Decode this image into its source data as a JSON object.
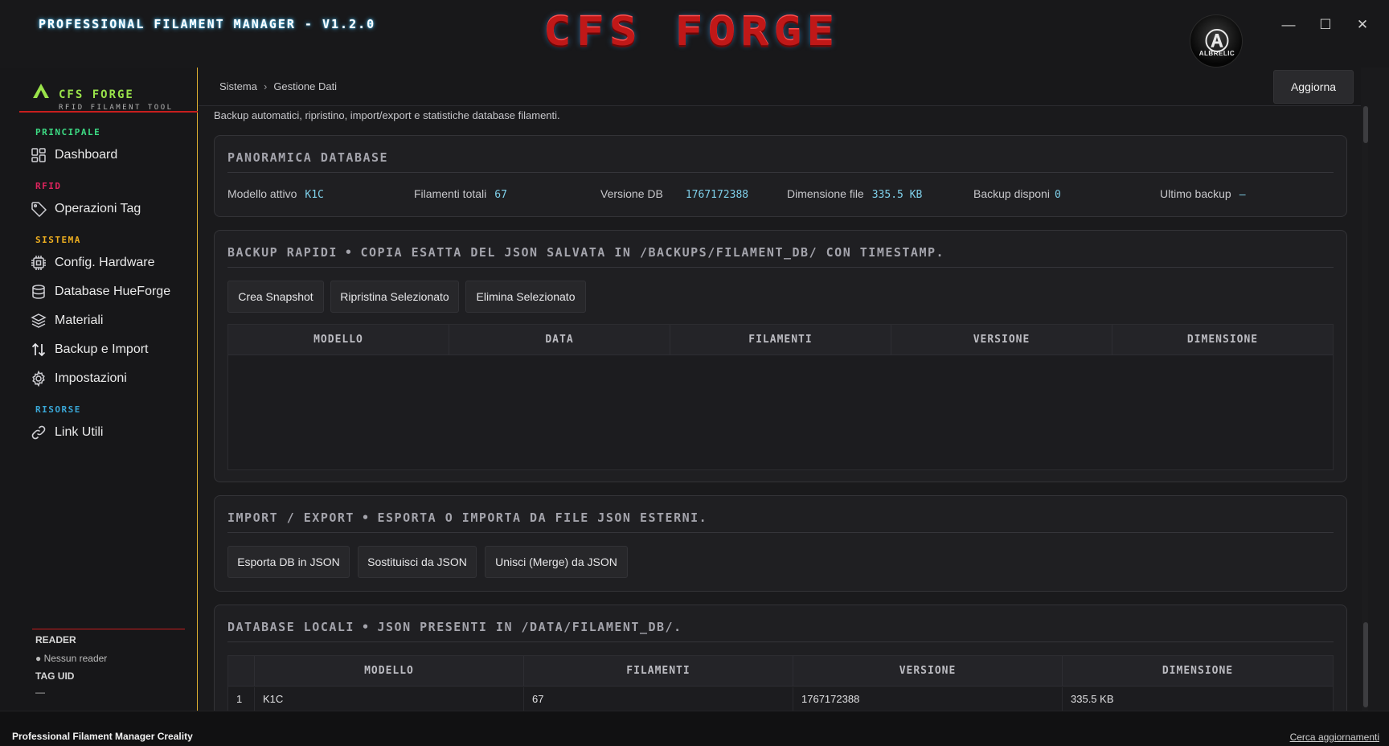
{
  "window": {
    "title": "PROFESSIONAL FILAMENT MANAGER - V1.2.0",
    "logo_text": "CFS FORGE",
    "avatar_label": "ALBRELIC",
    "controls": {
      "minimize": "—",
      "maximize": "☐",
      "close": "✕"
    }
  },
  "sidebar": {
    "brand_name": "CFS FORGE",
    "brand_sub": "RFID FILAMENT TOOL",
    "sections": [
      {
        "label": "PRINCIPALE",
        "color": "#3ddc84",
        "items": [
          {
            "label": "Dashboard",
            "icon": "dashboard-icon"
          }
        ]
      },
      {
        "label": "RFID",
        "color": "#e0245e",
        "items": [
          {
            "label": "Operazioni Tag",
            "icon": "tag-icon"
          }
        ]
      },
      {
        "label": "SISTEMA",
        "color": "#f0b020",
        "items": [
          {
            "label": "Config. Hardware",
            "icon": "chip-icon"
          },
          {
            "label": "Database HueForge",
            "icon": "database-icon"
          },
          {
            "label": "Materiali",
            "icon": "layers-icon"
          },
          {
            "label": "Backup e Import",
            "icon": "transfer-icon"
          },
          {
            "label": "Impostazioni",
            "icon": "gear-icon"
          }
        ]
      },
      {
        "label": "RISORSE",
        "color": "#3aa8d8",
        "items": [
          {
            "label": "Link Utili",
            "icon": "link-icon"
          }
        ]
      }
    ],
    "reader": {
      "title": "READER",
      "status": "● Nessun reader"
    },
    "tag": {
      "title": "TAG UID",
      "value": "—"
    }
  },
  "header": {
    "breadcrumb": [
      "Sistema",
      "Gestione Dati"
    ],
    "breadcrumb_sep": "›",
    "refresh_label": "Aggiorna"
  },
  "page": {
    "description": "Backup automatici, ripristino, import/export e statistiche database filamenti."
  },
  "overview": {
    "title": "PANORAMICA DATABASE",
    "stats": [
      {
        "label": "Modello attivo",
        "value": "K1C"
      },
      {
        "label": "Filamenti totali",
        "value": "67"
      },
      {
        "label": "Versione DB",
        "value": "1767172388"
      },
      {
        "label": "Dimensione file",
        "value": "335.5 KB"
      },
      {
        "label": "Backup disponi",
        "value": "0"
      },
      {
        "label": "Ultimo backup",
        "value": "—"
      }
    ]
  },
  "backup": {
    "title": "BACKUP RAPIDI",
    "subtitle": "COPIA ESATTA DEL JSON SALVATA IN /BACKUPS/FILAMENT_DB/ CON TIMESTAMP.",
    "buttons": [
      "Crea Snapshot",
      "Ripristina Selezionato",
      "Elimina Selezionato"
    ],
    "columns": [
      "MODELLO",
      "DATA",
      "FILAMENTI",
      "VERSIONE",
      "DIMENSIONE"
    ],
    "rows": []
  },
  "import_export": {
    "title": "IMPORT / EXPORT",
    "subtitle": "ESPORTA O IMPORTA DA FILE JSON ESTERNI.",
    "buttons": [
      "Esporta DB in JSON",
      "Sostituisci da JSON",
      "Unisci (Merge) da JSON"
    ]
  },
  "local_db": {
    "title": "DATABASE LOCALI",
    "subtitle": "JSON PRESENTI IN /DATA/FILAMENT_DB/.",
    "columns": [
      "MODELLO",
      "FILAMENTI",
      "VERSIONE",
      "DIMENSIONE"
    ],
    "rows": [
      {
        "index": "1",
        "cells": [
          "K1C",
          "67",
          "1767172388",
          "335.5 KB"
        ]
      }
    ]
  },
  "statusbar": {
    "left": "Professional Filament Manager Creality",
    "right": "Cerca aggiornamenti"
  },
  "colors": {
    "accent_red": "#c81e1e",
    "accent_yellow": "#e0b030",
    "value_cyan": "#7fd0ea"
  }
}
